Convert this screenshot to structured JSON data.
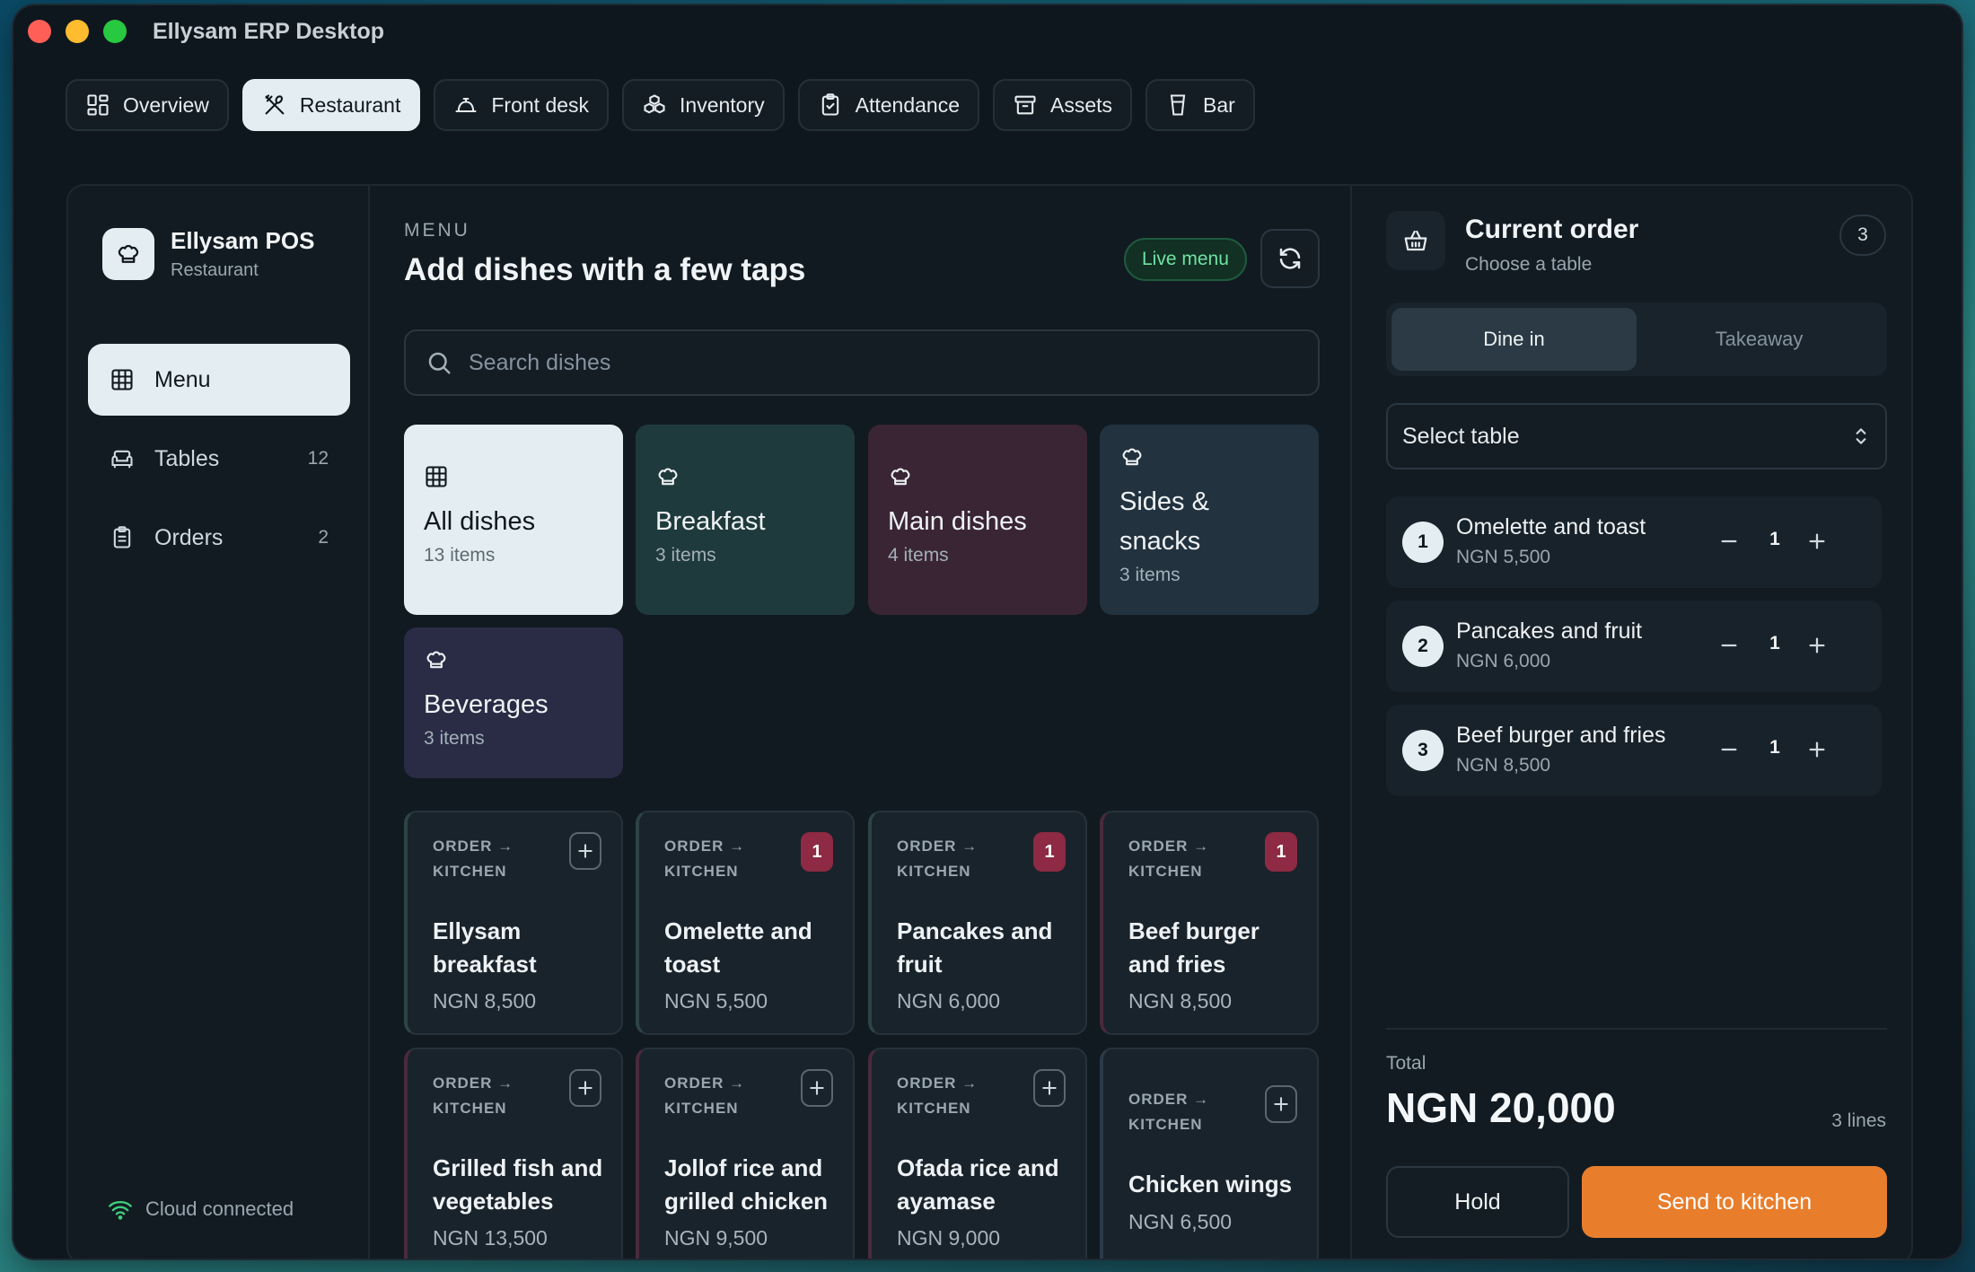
{
  "window": {
    "title": "Ellysam ERP Desktop"
  },
  "modules": [
    {
      "label": "Overview",
      "icon": "grid-icon"
    },
    {
      "label": "Restaurant",
      "icon": "utensils-icon",
      "active": true
    },
    {
      "label": "Front desk",
      "icon": "bell-icon"
    },
    {
      "label": "Inventory",
      "icon": "boxes-icon"
    },
    {
      "label": "Attendance",
      "icon": "clipboard-check-icon"
    },
    {
      "label": "Assets",
      "icon": "archive-icon"
    },
    {
      "label": "Bar",
      "icon": "cup-icon"
    }
  ],
  "sidebar": {
    "brand_title": "Ellysam POS",
    "brand_sub": "Restaurant",
    "items": [
      {
        "label": "Menu",
        "icon": "table-grid-icon",
        "active": true,
        "count": ""
      },
      {
        "label": "Tables",
        "icon": "armchair-icon",
        "count": "12"
      },
      {
        "label": "Orders",
        "icon": "clipboard-icon",
        "count": "2"
      }
    ],
    "status": "Cloud connected"
  },
  "menu": {
    "kicker": "MENU",
    "title": "Add dishes with a few taps",
    "live_badge": "Live menu",
    "search_placeholder": "Search dishes",
    "categories": [
      {
        "name": "All dishes",
        "count": "13 items",
        "color": "#e4eef2"
      },
      {
        "name": "Breakfast",
        "count": "3 items",
        "color": "#1f3a3c"
      },
      {
        "name": "Main dishes",
        "count": "4 items",
        "color": "#3a2535"
      },
      {
        "name": "Sides & snacks",
        "count": "3 items",
        "color": "#22323f"
      },
      {
        "name": "Beverages",
        "count": "3 items",
        "color": "#2a2b45"
      }
    ],
    "dish_tag_line1": "ORDER →",
    "dish_tag_line2": "KITCHEN",
    "dishes": [
      {
        "name": "Ellysam breakfast",
        "price": "NGN 8,500",
        "qty": ""
      },
      {
        "name": "Omelette and toast",
        "price": "NGN 5,500",
        "qty": "1"
      },
      {
        "name": "Pancakes and fruit",
        "price": "NGN 6,000",
        "qty": "1"
      },
      {
        "name": "Beef burger and fries",
        "price": "NGN 8,500",
        "qty": "1"
      },
      {
        "name": "Grilled fish and vegetables",
        "price": "NGN 13,500",
        "qty": ""
      },
      {
        "name": "Jollof rice and grilled chicken",
        "price": "NGN 9,500",
        "qty": ""
      },
      {
        "name": "Ofada rice and ayamase",
        "price": "NGN 9,000",
        "qty": ""
      },
      {
        "name": "Chicken wings",
        "price": "NGN 6,500",
        "qty": ""
      }
    ]
  },
  "order": {
    "title": "Current order",
    "subtitle": "Choose a table",
    "count": "3",
    "modes": [
      "Dine in",
      "Takeaway"
    ],
    "active_mode": "Dine in",
    "table_select": "Select table",
    "lines": [
      {
        "num": "1",
        "name": "Omelette and toast",
        "price": "NGN 5,500",
        "qty": "1"
      },
      {
        "num": "2",
        "name": "Pancakes and fruit",
        "price": "NGN 6,000",
        "qty": "1"
      },
      {
        "num": "3",
        "name": "Beef burger and fries",
        "price": "NGN 8,500",
        "qty": "1"
      }
    ],
    "total_label": "Total",
    "total_value": "NGN 20,000",
    "lines_count": "3 lines",
    "hold_label": "Hold",
    "send_label": "Send to kitchen"
  },
  "colors": {
    "accent": "#e87e2c",
    "badge": "#8e2a43",
    "live": "#6fe3a3"
  }
}
